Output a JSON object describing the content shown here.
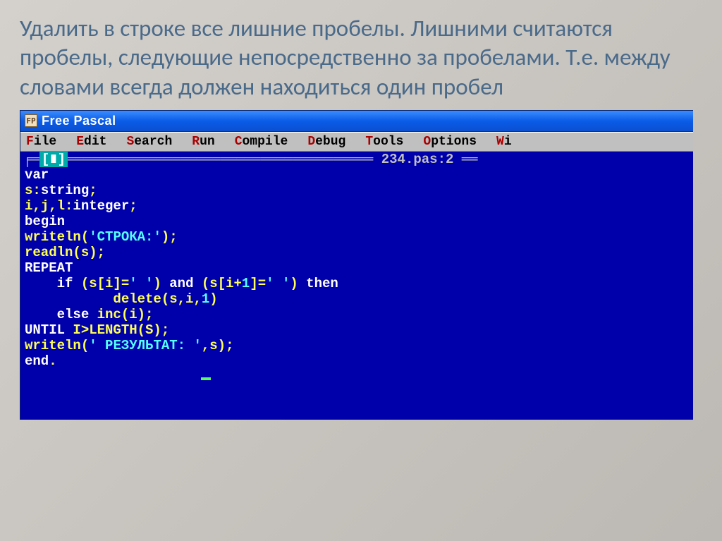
{
  "description": "Удалить в строке все лишние пробелы. Лишними считаются пробелы, следующие непосредственно за пробелами. Т.е. между словами всегда должен находиться один пробел",
  "window": {
    "title": "Free Pascal",
    "icon_label": "FP"
  },
  "menu": {
    "file": "File",
    "edit": "Edit",
    "search": "Search",
    "run": "Run",
    "compile": "Compile",
    "debug": "Debug",
    "tools": "Tools",
    "options": "Options",
    "window": "Wi"
  },
  "editor": {
    "tab_marker": "[∎]",
    "filename": "234.pas:2",
    "code": {
      "l1_var": "var",
      "l2_s": "s:",
      "l2_string": "string",
      "l2_semi": ";",
      "l3_ijl": "i,j,l:",
      "l3_integer": "integer",
      "l3_semi": ";",
      "l4_begin": "begin",
      "l5_writeln": "writeln",
      "l5_open": "(",
      "l5_str": "'СТРОКА:'",
      "l5_close": ");",
      "l6_readln": "readln",
      "l6_args": "(s);",
      "l7_repeat": "REPEAT",
      "l8_indent": "    ",
      "l8_if": "if",
      "l8_expr1": " (s[i]=",
      "l8_str1": "' '",
      "l8_expr2": ") ",
      "l8_and": "and",
      "l8_expr3": " (s[i+",
      "l8_num": "1",
      "l8_expr4": "]=",
      "l8_str2": "' '",
      "l8_expr5": ") ",
      "l8_then": "then",
      "l9_indent": "           ",
      "l9_delete": "delete(s,i,",
      "l9_num": "1",
      "l9_close": ")",
      "l10_indent": "    ",
      "l10_else": "else",
      "l10_inc": " inc(i);",
      "l11_until": "UNTIL",
      "l11_cond": " I>LENGTH(S);",
      "l12_writeln": "writeln",
      "l12_open": "(",
      "l12_str": "' РЕЗУЛЬТАТ: '",
      "l12_close": ",s);",
      "l13_end": "end",
      "l13_dot": "."
    }
  }
}
